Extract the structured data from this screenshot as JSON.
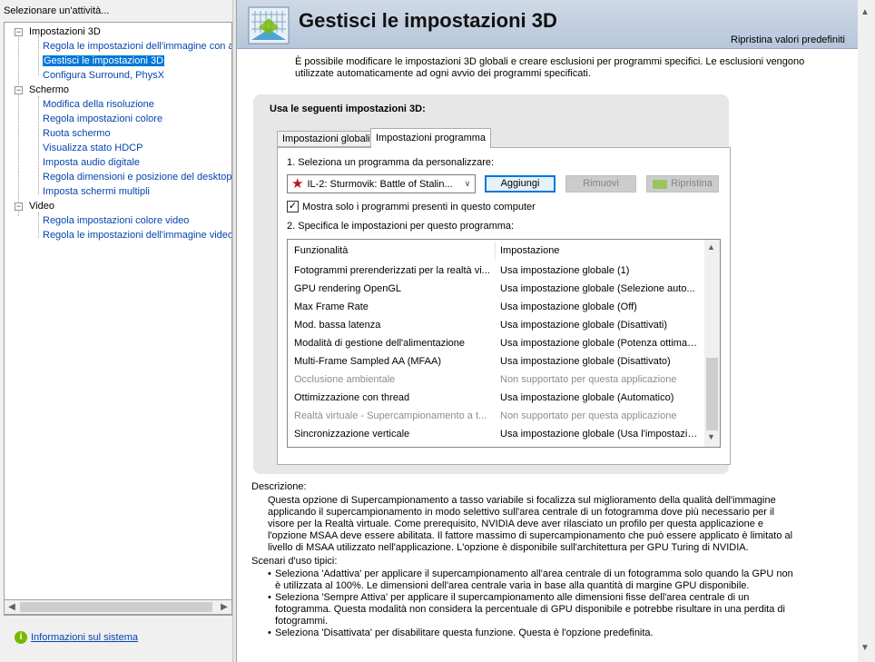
{
  "left": {
    "header": "Selezionare un'attività...",
    "tree": [
      {
        "label": "Impostazioni 3D",
        "level": 0
      },
      {
        "label": "Regola le impostazioni dell'immagine con an",
        "level": 1
      },
      {
        "label": "Gestisci le impostazioni 3D",
        "level": 1,
        "selected": true
      },
      {
        "label": "Configura Surround, PhysX",
        "level": 1
      },
      {
        "label": "Schermo",
        "level": 0
      },
      {
        "label": "Modifica della risoluzione",
        "level": 1
      },
      {
        "label": "Regola impostazioni colore",
        "level": 1
      },
      {
        "label": "Ruota schermo",
        "level": 1
      },
      {
        "label": "Visualizza stato HDCP",
        "level": 1
      },
      {
        "label": "Imposta audio digitale",
        "level": 1
      },
      {
        "label": "Regola dimensioni e posizione del desktop",
        "level": 1
      },
      {
        "label": "Imposta schermi multipli",
        "level": 1
      },
      {
        "label": "Video",
        "level": 0
      },
      {
        "label": "Regola impostazioni colore video",
        "level": 1
      },
      {
        "label": "Regola le impostazioni dell'immagine video",
        "level": 1
      }
    ],
    "sysinfo": "Informazioni sul sistema"
  },
  "right": {
    "title": "Gestisci le impostazioni 3D",
    "restore": "Ripristina valori predefiniti",
    "intro": "È possibile modificare le impostazioni 3D globali e creare esclusioni per programmi specifici. Le esclusioni vengono utilizzate automaticamente ad ogni avvio dei programmi specificati.",
    "panel_title": "Usa le seguenti impostazioni 3D:",
    "tabs": {
      "global": "Impostazioni globali",
      "program": "Impostazioni programma"
    },
    "select_label": "1. Seleziona un programma da personalizzare:",
    "program_value": "IL-2: Sturmovik: Battle of Stalin...",
    "buttons": {
      "add": "Aggiungi",
      "remove": "Rimuovi",
      "restore": "Ripristina"
    },
    "checkbox_label": "Mostra solo i programmi presenti in questo computer",
    "spec_label": "2. Specifica le impostazioni per questo programma:",
    "table_headers": {
      "feature": "Funzionalità",
      "setting": "Impostazione"
    },
    "rows": [
      {
        "feature": "Fotogrammi prerenderizzati per la realtà vi...",
        "setting": "Usa impostazione globale (1)",
        "disabled": false
      },
      {
        "feature": "GPU rendering OpenGL",
        "setting": "Usa impostazione globale (Selezione auto...",
        "disabled": false
      },
      {
        "feature": "Max Frame Rate",
        "setting": "Usa impostazione globale (Off)",
        "disabled": false
      },
      {
        "feature": "Mod. bassa latenza",
        "setting": "Usa impostazione globale (Disattivati)",
        "disabled": false
      },
      {
        "feature": "Modalità di gestione dell'alimentazione",
        "setting": "Usa impostazione globale (Potenza ottimale)",
        "disabled": false
      },
      {
        "feature": "Multi-Frame Sampled AA (MFAA)",
        "setting": "Usa impostazione globale (Disattivato)",
        "disabled": false
      },
      {
        "feature": "Occlusione ambientale",
        "setting": "Non supportato per questa applicazione",
        "disabled": true
      },
      {
        "feature": "Ottimizzazione con thread",
        "setting": "Usa impostazione globale (Automatico)",
        "disabled": false
      },
      {
        "feature": "Realtà virtuale - Supercampionamento a t...",
        "setting": "Non supportato per questa applicazione",
        "disabled": true
      },
      {
        "feature": "Sincronizzazione verticale",
        "setting": "Usa impostazione globale (Usa l'impostazio...",
        "disabled": false
      }
    ],
    "desc_title": "Descrizione:",
    "desc_body": "Questa opzione di Supercampionamento a tasso variabile si focalizza sul miglioramento della qualità dell'immagine applicando il supercampionamento in modo selettivo sull'area centrale di un fotogramma dove più necessario per il visore per la Realtà virtuale. Come prerequisito, NVIDIA deve aver rilasciato un profilo per questa applicazione e l'opzione MSAA deve essere abilitata. Il fattore massimo di supercampionamento che può essere applicato è limitato al livello di MSAA utilizzato nell'applicazione. L'opzione è disponibile sull'architettura per GPU Turing di NVIDIA.",
    "usage_title": "Scenari d'uso tipici:",
    "usage": [
      "Seleziona 'Adattiva' per applicare il supercampionamento all'area centrale di un fotogramma solo quando la GPU non è utilizzata al 100%. Le dimensioni dell'area centrale varia in base alla quantità di margine GPU disponibile.",
      "Seleziona 'Sempre Attiva' per applicare il supercampionamento alle dimensioni fisse dell'area centrale di un fotogramma. Questa modalità non considera la percentuale di GPU disponibile e potrebbe risultare in una perdita di fotogrammi.",
      "Seleziona 'Disattivata' per disabilitare questa funzione. Questa è l'opzione predefinita."
    ]
  }
}
